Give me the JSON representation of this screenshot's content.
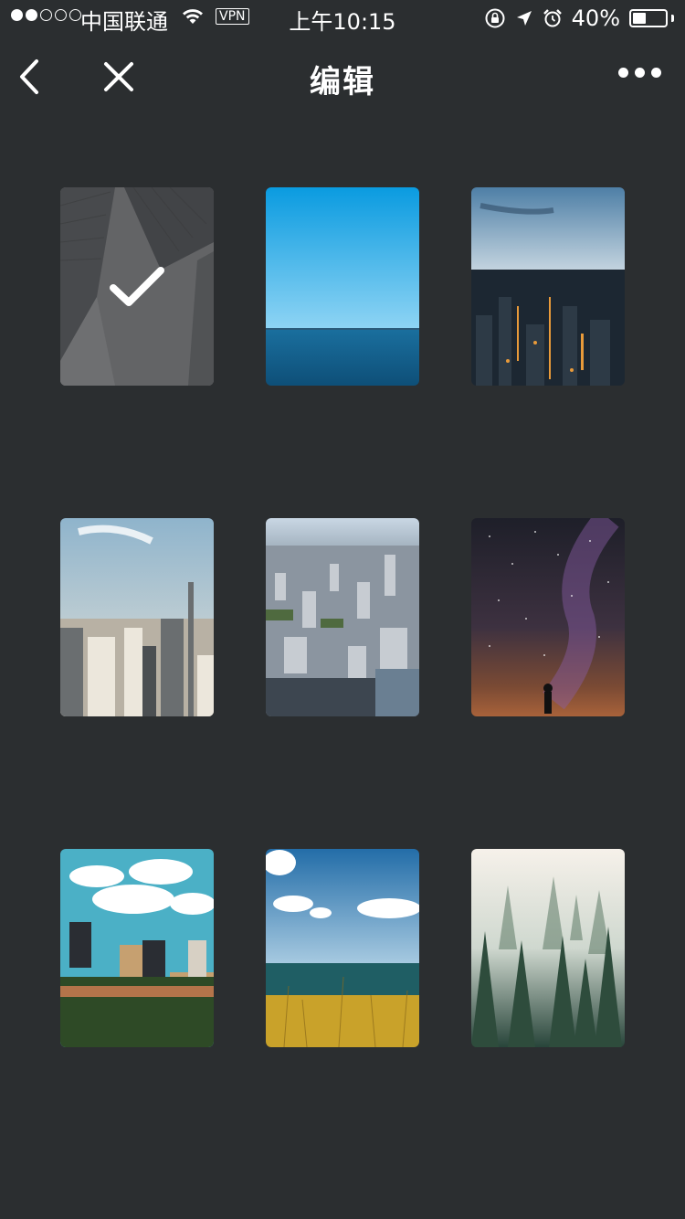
{
  "status_bar": {
    "carrier": "中国联通",
    "vpn": "VPN",
    "time": "上午10:15",
    "battery_text": "40%",
    "battery_level": 0.4,
    "signal_strength": 2,
    "signal_total": 5
  },
  "nav": {
    "title": "编辑",
    "back_icon": "chevron-left-icon",
    "close_icon": "close-icon",
    "more_icon": "more-horizontal-icon"
  },
  "photos": [
    {
      "name": "buildings-looking-up",
      "selected": true
    },
    {
      "name": "ocean-horizon",
      "selected": false
    },
    {
      "name": "city-night-aerial",
      "selected": false
    },
    {
      "name": "manhattan-skyline",
      "selected": false
    },
    {
      "name": "city-aerial-day",
      "selected": false
    },
    {
      "name": "milky-way-silhouette",
      "selected": false
    },
    {
      "name": "city-skyline-clouds",
      "selected": false
    },
    {
      "name": "beach-grass-sky",
      "selected": false
    },
    {
      "name": "foggy-forest",
      "selected": false
    }
  ],
  "colors": {
    "background": "#2b2e30",
    "foreground": "#ffffff"
  }
}
